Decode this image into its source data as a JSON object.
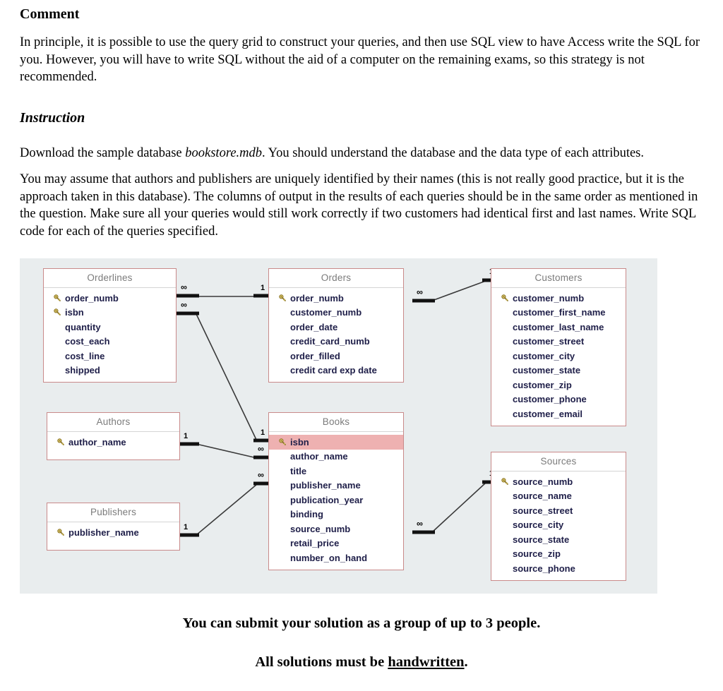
{
  "document": {
    "comment_heading": "Comment",
    "comment_paragraph": "In principle, it is possible to use the query grid to construct your queries, and then use SQL view to have Access write the SQL for you.  However, you will have to write SQL without the aid of a computer on the remaining exams, so this strategy is not recommended.",
    "instruction_heading": "Instruction",
    "instruction_paragraph_1_before": "Download the sample database ",
    "instruction_paragraph_1_italic": "bookstore.mdb",
    "instruction_paragraph_1_after": ". You should understand the database and the data type of each attributes.",
    "instruction_paragraph_2": "You may assume that authors and publishers are uniquely identified by their names (this is not really good practice, but it is the approach taken in this database).  The columns of output in the results of each queries should be in the same order as mentioned in the question.  Make sure all your queries would still work correctly if two customers had identical first and last names. Write SQL code for each of the queries specified.",
    "footer_line_1": "You can submit your solution as a group of up to 3 people.",
    "footer_line_2_before": "All solutions must be ",
    "footer_line_2_underlined": "handwritten",
    "footer_line_2_after": "."
  },
  "er_diagram": {
    "panel_background": "#e9edee",
    "table_border_color": "#c98a8a",
    "highlight_color": "#eeb1b1",
    "field_text_color": "#20204a",
    "title_text_color": "#7b7b7b",
    "tables": [
      {
        "name": "Orderlines",
        "fields": [
          {
            "label": "order_numb",
            "key": true,
            "highlight": false
          },
          {
            "label": "isbn",
            "key": true,
            "highlight": false
          },
          {
            "label": "quantity",
            "key": false,
            "highlight": false
          },
          {
            "label": "cost_each",
            "key": false,
            "highlight": false
          },
          {
            "label": "cost_line",
            "key": false,
            "highlight": false
          },
          {
            "label": "shipped",
            "key": false,
            "highlight": false
          }
        ]
      },
      {
        "name": "Orders",
        "fields": [
          {
            "label": "order_numb",
            "key": true,
            "highlight": false
          },
          {
            "label": "customer_numb",
            "key": false,
            "highlight": false
          },
          {
            "label": "order_date",
            "key": false,
            "highlight": false
          },
          {
            "label": "credit_card_numb",
            "key": false,
            "highlight": false
          },
          {
            "label": "order_filled",
            "key": false,
            "highlight": false
          },
          {
            "label": "credit card exp date",
            "key": false,
            "highlight": false
          }
        ]
      },
      {
        "name": "Customers",
        "fields": [
          {
            "label": "customer_numb",
            "key": true,
            "highlight": false
          },
          {
            "label": "customer_first_name",
            "key": false,
            "highlight": false
          },
          {
            "label": "customer_last_name",
            "key": false,
            "highlight": false
          },
          {
            "label": "customer_street",
            "key": false,
            "highlight": false
          },
          {
            "label": "customer_city",
            "key": false,
            "highlight": false
          },
          {
            "label": "customer_state",
            "key": false,
            "highlight": false
          },
          {
            "label": "customer_zip",
            "key": false,
            "highlight": false
          },
          {
            "label": "customer_phone",
            "key": false,
            "highlight": false
          },
          {
            "label": "customer_email",
            "key": false,
            "highlight": false
          }
        ]
      },
      {
        "name": "Authors",
        "fields": [
          {
            "label": "author_name",
            "key": true,
            "highlight": false
          }
        ]
      },
      {
        "name": "Books",
        "fields": [
          {
            "label": "isbn",
            "key": true,
            "highlight": true
          },
          {
            "label": "author_name",
            "key": false,
            "highlight": false
          },
          {
            "label": "title",
            "key": false,
            "highlight": false
          },
          {
            "label": "publisher_name",
            "key": false,
            "highlight": false
          },
          {
            "label": "publication_year",
            "key": false,
            "highlight": false
          },
          {
            "label": "binding",
            "key": false,
            "highlight": false
          },
          {
            "label": "source_numb",
            "key": false,
            "highlight": false
          },
          {
            "label": "retail_price",
            "key": false,
            "highlight": false
          },
          {
            "label": "number_on_hand",
            "key": false,
            "highlight": false
          }
        ]
      },
      {
        "name": "Publishers",
        "fields": [
          {
            "label": "publisher_name",
            "key": true,
            "highlight": false
          }
        ]
      },
      {
        "name": "Sources",
        "fields": [
          {
            "label": "source_numb",
            "key": true,
            "highlight": false
          },
          {
            "label": "source_name",
            "key": false,
            "highlight": false
          },
          {
            "label": "source_street",
            "key": false,
            "highlight": false
          },
          {
            "label": "source_city",
            "key": false,
            "highlight": false
          },
          {
            "label": "source_state",
            "key": false,
            "highlight": false
          },
          {
            "label": "source_zip",
            "key": false,
            "highlight": false
          },
          {
            "label": "source_phone",
            "key": false,
            "highlight": false
          }
        ]
      }
    ],
    "relationships": [
      {
        "from": "Orderlines",
        "to": "Orders",
        "from_cardinality": "∞",
        "to_cardinality": "1"
      },
      {
        "from": "Orderlines",
        "to": "Books",
        "from_cardinality": "∞",
        "to_cardinality": "1"
      },
      {
        "from": "Orders",
        "to": "Customers",
        "from_cardinality": "∞",
        "to_cardinality": "1"
      },
      {
        "from": "Authors",
        "to": "Books",
        "from_cardinality": "1",
        "to_cardinality": "∞"
      },
      {
        "from": "Publishers",
        "to": "Books",
        "from_cardinality": "1",
        "to_cardinality": "∞"
      },
      {
        "from": "Books",
        "to": "Sources",
        "from_cardinality": "∞",
        "to_cardinality": "1"
      }
    ]
  }
}
